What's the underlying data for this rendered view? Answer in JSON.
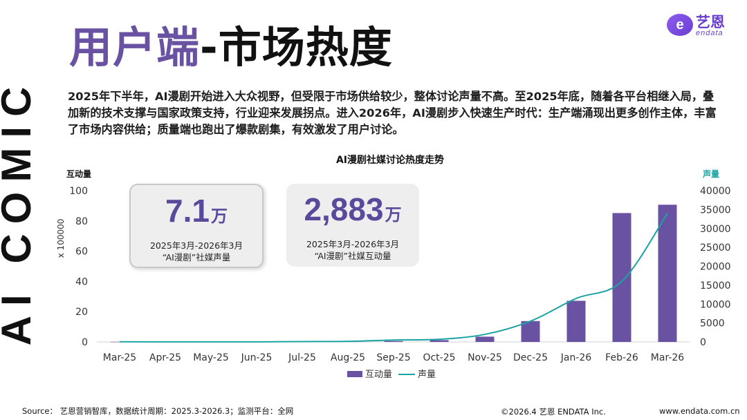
{
  "side_text": "AI COMIC",
  "title": {
    "part1": "用户端",
    "part2": "-市场热度"
  },
  "logo": {
    "cn": "艺恩",
    "en": "endata",
    "mark": "e"
  },
  "intro": "2025年下半年，AI漫剧开始进入大众视野，但受限于市场供给较少，整体讨论声量不高。至2025年底，随着各平台相继入局，叠加新的技术支撑与国家政策支持，行业迎来发展拐点。进入2026年，AI漫剧步入快速生产时代：生产端涌现出更多创作主体，丰富了市场内容供给；质量端也跑出了爆款剧集，有效激发了用户讨论。",
  "cards": {
    "volume": {
      "value": "7.1",
      "unit": "万",
      "period": "2025年3月-2026年3月",
      "label": "“AI漫剧”社媒声量"
    },
    "interact": {
      "value": "2,883",
      "unit": "万",
      "period": "2025年3月-2026年3月",
      "label": "“AI漫剧”社媒互动量"
    }
  },
  "chart_data": {
    "type": "bar",
    "title": "AI漫剧社媒讨论热度走势",
    "categories": [
      "Mar-25",
      "Apr-25",
      "May-25",
      "Jun-25",
      "Jul-25",
      "Aug-25",
      "Sep-25",
      "Oct-25",
      "Nov-25",
      "Dec-25",
      "Jan-26",
      "Feb-26",
      "Mar-26"
    ],
    "left_axis": {
      "label": "互动量",
      "multiplier_label": "x 100000",
      "ylim": [
        0,
        100
      ],
      "ticks": [
        0,
        20,
        40,
        60,
        80,
        100
      ]
    },
    "right_axis": {
      "label": "声量",
      "ylim": [
        0,
        40000
      ],
      "ticks": [
        0,
        5000,
        10000,
        15000,
        20000,
        25000,
        30000,
        35000,
        40000
      ]
    },
    "series": [
      {
        "name": "互动量",
        "type": "bar",
        "axis": "left",
        "color": "#6a52a3",
        "values": [
          0.1,
          0.1,
          0.2,
          0.1,
          0.2,
          0.3,
          0.6,
          1.2,
          3.5,
          13.8,
          27.2,
          85.2,
          90.7
        ]
      },
      {
        "name": "声量",
        "type": "line",
        "axis": "right",
        "color": "#1aa3a3",
        "values": [
          50,
          20,
          30,
          20,
          100,
          150,
          500,
          700,
          2000,
          5500,
          11500,
          16000,
          34000
        ]
      }
    ],
    "legend_position": "bottom",
    "grid": false
  },
  "footer": {
    "source": "Source： 艺恩营销智库，数据统计周期：2025.3-2026.3；监测平台：全网",
    "copyright": "©2026.4 艺恩 ENDATA Inc.",
    "url": "www.endata.com.cn"
  }
}
